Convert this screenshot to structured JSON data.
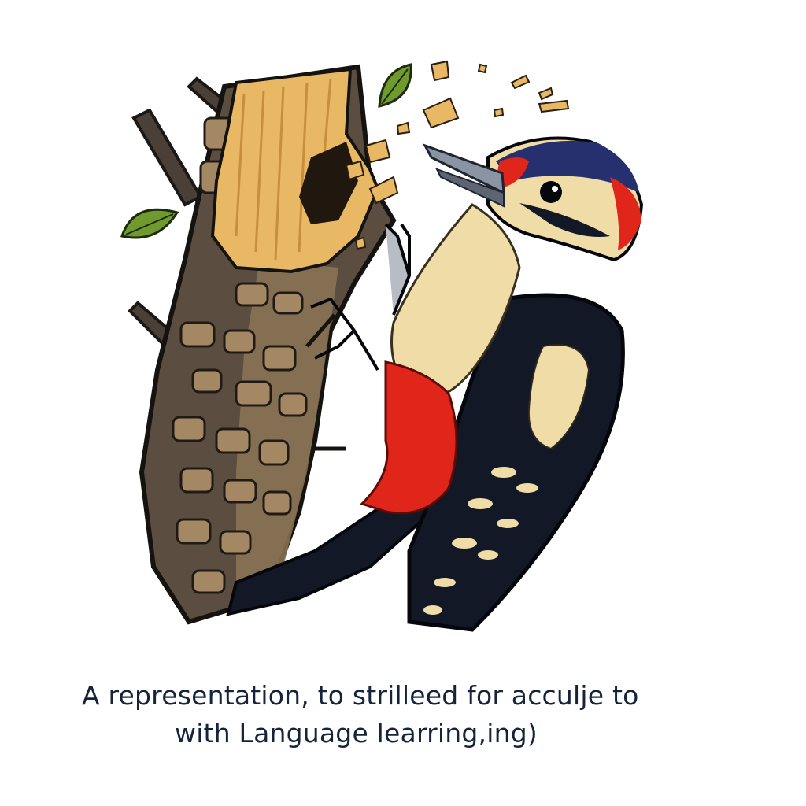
{
  "caption": {
    "line1": "A representation,  to strilleed for acculje to",
    "line2": "with Language learring,ing)"
  },
  "colors": {
    "background": "#ffffff",
    "bark_dark": "#3a3530",
    "bark_light": "#7d6a52",
    "exposed_wood": "#e9b864",
    "bird_black": "#121826",
    "bird_cream": "#efdca7",
    "bird_red": "#e0251a",
    "bird_crown": "#27306e",
    "leaf_green": "#6f9a2d",
    "caption_text": "#15243a"
  },
  "illustration": {
    "subject": "woodpecker-pecking-tree",
    "elements": [
      "tree-trunk",
      "wood-chips",
      "leaves",
      "woodpecker"
    ]
  }
}
